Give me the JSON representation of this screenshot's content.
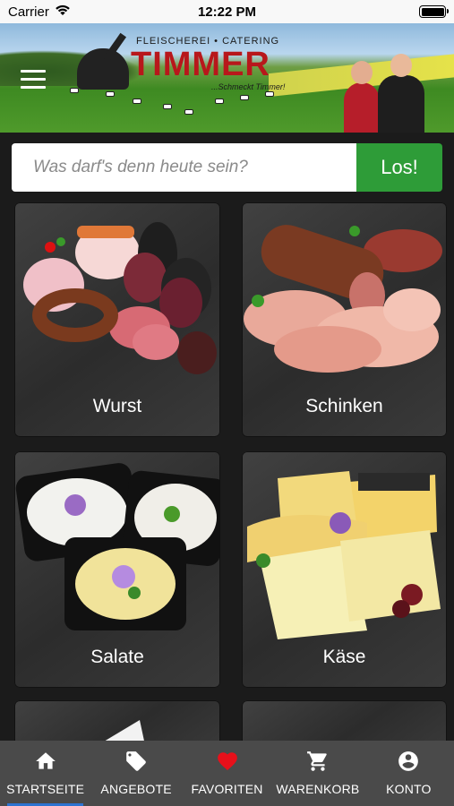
{
  "status_bar": {
    "carrier": "Carrier",
    "time": "12:22 PM"
  },
  "brand": {
    "kicker": "FLEISCHEREI • CATERING",
    "name": "TIMMER",
    "slogan": "...Schmeckt Timmer!"
  },
  "search": {
    "placeholder": "Was darf's denn heute sein?",
    "button_label": "Los!"
  },
  "categories": [
    {
      "label": "Wurst"
    },
    {
      "label": "Schinken"
    },
    {
      "label": "Salate"
    },
    {
      "label": "Käse"
    }
  ],
  "tabs": [
    {
      "label": "STARTSEITE",
      "icon": "home-icon",
      "active": true
    },
    {
      "label": "ANGEBOTE",
      "icon": "tag-icon"
    },
    {
      "label": "FAVORITEN",
      "icon": "heart-icon"
    },
    {
      "label": "WARENKORB",
      "icon": "cart-icon"
    },
    {
      "label": "KONTO",
      "icon": "account-icon"
    }
  ],
  "colors": {
    "brand_red": "#b8171b",
    "search_button": "#2e9c38",
    "tab_bar": "#4a4a4a",
    "active_tab_indicator": "#2c73d2",
    "favorite_heart": "#e8101a"
  }
}
